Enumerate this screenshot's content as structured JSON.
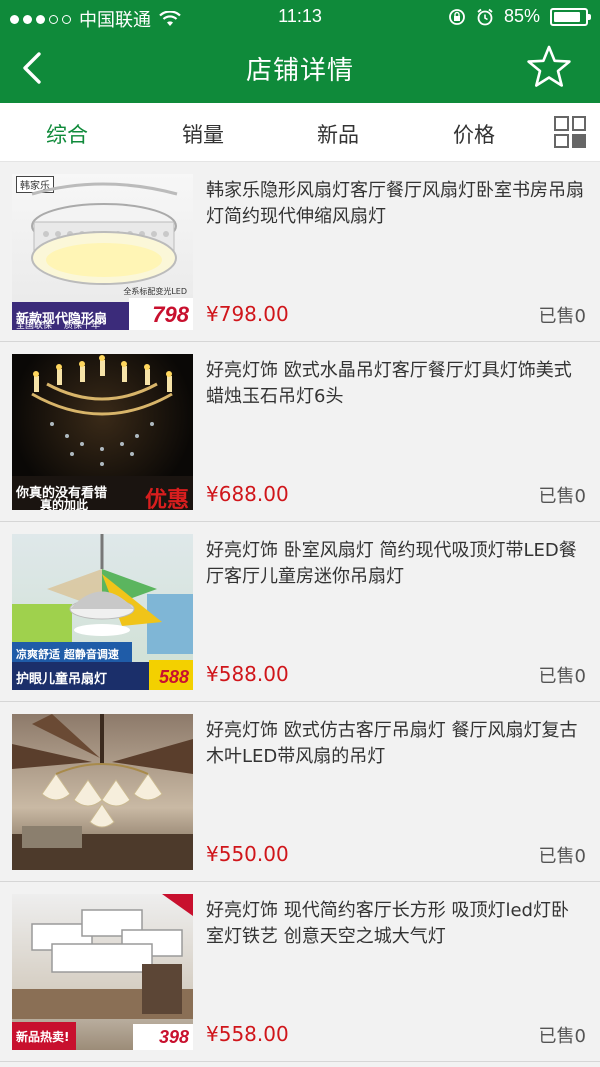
{
  "status_bar": {
    "carrier": "中国联通",
    "time": "11:13",
    "battery": "85%",
    "battery_level": 0.85
  },
  "nav": {
    "title": "店铺详情"
  },
  "tabs": [
    "综合",
    "销量",
    "新品",
    "价格"
  ],
  "active_tab": 0,
  "products": [
    {
      "name": "韩家乐隐形风扇灯客厅餐厅风扇灯卧室书房吊扇灯简约现代伸缩风扇灯",
      "price": "¥798.00",
      "sold": "已售0",
      "image_banner": "新款现代隐形扇",
      "image_sub": "全国联保",
      "image_sub2": "质保十年",
      "image_tag_price": "798",
      "image_mini": "全系标配变光LED",
      "image_logo": "韩家乐"
    },
    {
      "name": "好亮灯饰 欧式水晶吊灯客厅餐厅灯具灯饰美式蜡烛玉石吊灯6头",
      "price": "¥688.00",
      "sold": "已售0",
      "image_banner": "你真的没有看错",
      "image_sub": "真的加此",
      "image_tag_price": "优惠"
    },
    {
      "name": "好亮灯饰 卧室风扇灯 简约现代吸顶灯带LED餐厅客厅儿童房迷你吊扇灯",
      "price": "¥588.00",
      "sold": "已售0",
      "image_banner": "凉爽舒适  超静音调速",
      "image_sub": "护眼儿童吊扇灯",
      "image_tag_price": "588"
    },
    {
      "name": "好亮灯饰 欧式仿古客厅吊扇灯 餐厅风扇灯复古木叶LED带风扇的吊灯",
      "price": "¥550.00",
      "sold": "已售0"
    },
    {
      "name": "好亮灯饰 现代简约客厅长方形 吸顶灯led灯卧室灯铁艺 创意天空之城大气灯",
      "price": "¥558.00",
      "sold": "已售0",
      "image_banner": "新品热卖!",
      "image_tag_price": "398"
    }
  ]
}
